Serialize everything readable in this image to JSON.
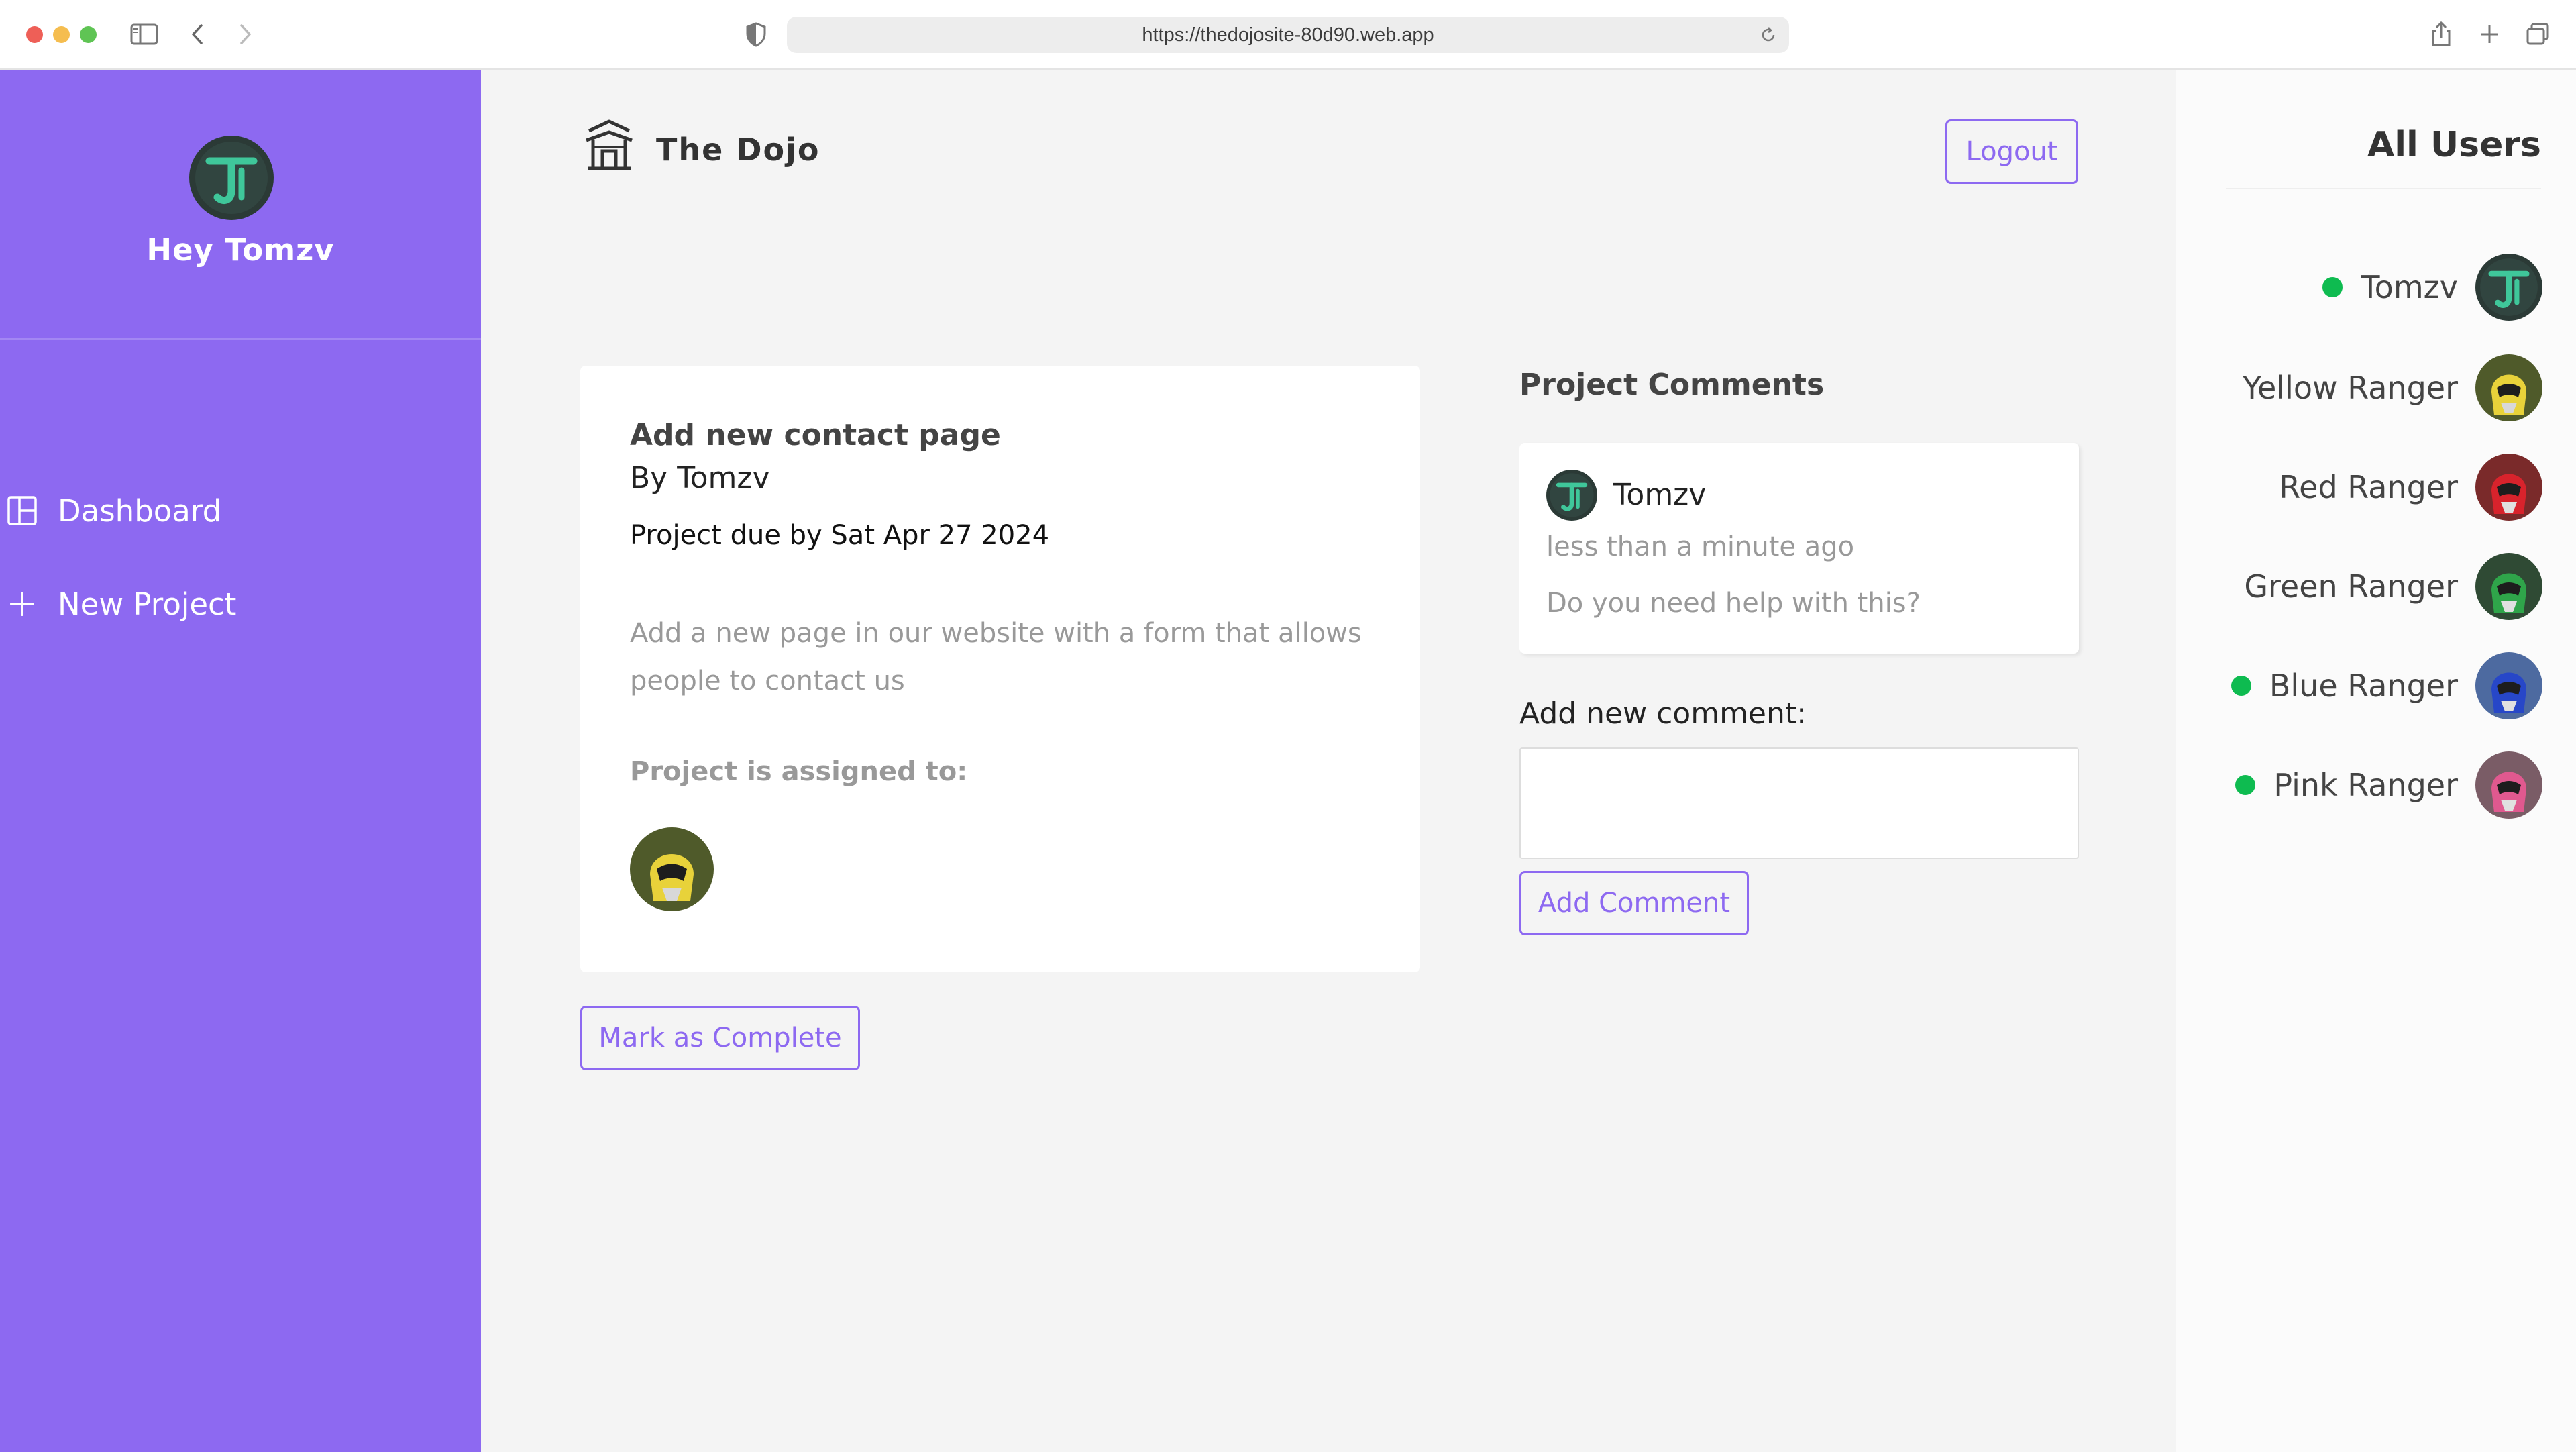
{
  "browser": {
    "url": "https://thedojosite-80d90.web.app"
  },
  "sidebar": {
    "greeting": "Hey Tomzv",
    "nav": [
      {
        "label": "Dashboard",
        "icon": "dashboard-icon"
      },
      {
        "label": "New Project",
        "icon": "plus-icon"
      }
    ]
  },
  "navbar": {
    "brand": "The Dojo",
    "logout_label": "Logout"
  },
  "project": {
    "title": "Add new contact page",
    "author": "By Tomzv",
    "due": "Project due by Sat Apr 27 2024",
    "details": "Add a new page in our website with a form that allows people to contact us",
    "assigned_label": "Project is assigned to:",
    "assignees": [
      "Yellow Ranger"
    ],
    "complete_label": "Mark as Complete"
  },
  "comments": {
    "heading": "Project Comments",
    "items": [
      {
        "author": "Tomzv",
        "time": "less than a minute ago",
        "content": "Do you need help with this?"
      }
    ],
    "new_label": "Add new comment:",
    "new_value": "",
    "submit_label": "Add Comment"
  },
  "users": {
    "heading": "All Users",
    "list": [
      {
        "name": "Tomzv",
        "online": true,
        "avatar": "tomzv-avatar"
      },
      {
        "name": "Yellow Ranger",
        "online": false,
        "avatar": "yellow-ranger-avatar"
      },
      {
        "name": "Red Ranger",
        "online": false,
        "avatar": "red-ranger-avatar"
      },
      {
        "name": "Green Ranger",
        "online": false,
        "avatar": "green-ranger-avatar"
      },
      {
        "name": "Blue Ranger",
        "online": true,
        "avatar": "blue-ranger-avatar"
      },
      {
        "name": "Pink Ranger",
        "online": true,
        "avatar": "pink-ranger-avatar"
      }
    ]
  },
  "colors": {
    "primary": "#8d69f1",
    "background": "#f4f4f4",
    "online": "#0ebb50"
  }
}
